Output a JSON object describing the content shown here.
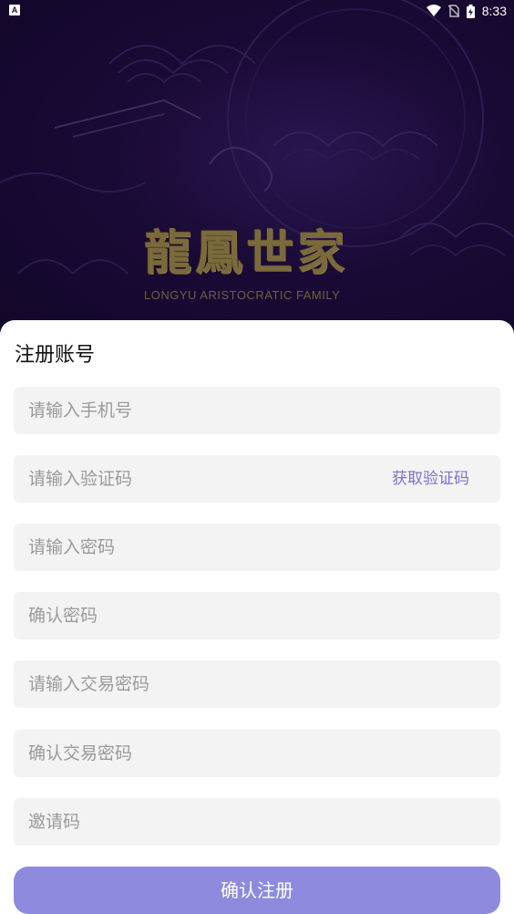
{
  "status_bar": {
    "notification_icon_letter": "A",
    "time": "8:33",
    "icons": [
      "wifi-icon",
      "no-sim-icon",
      "battery-charging-icon"
    ]
  },
  "banner": {
    "logo_characters": "龍鳳世家",
    "logo_subtitle": "LONGYU ARISTOCRATIC FAMILY"
  },
  "form": {
    "title": "注册账号",
    "fields": [
      {
        "name": "phone",
        "placeholder": "请输入手机号",
        "value": ""
      },
      {
        "name": "verification_code",
        "placeholder": "请输入验证码",
        "value": ""
      },
      {
        "name": "password",
        "placeholder": "请输入密码",
        "value": ""
      },
      {
        "name": "confirm_password",
        "placeholder": "确认密码",
        "value": ""
      },
      {
        "name": "trade_password",
        "placeholder": "请输入交易密码",
        "value": ""
      },
      {
        "name": "confirm_trade_password",
        "placeholder": "确认交易密码",
        "value": ""
      },
      {
        "name": "invite_code",
        "placeholder": "邀请码",
        "value": ""
      }
    ],
    "get_code_label": "获取验证码",
    "submit_label": "确认注册"
  },
  "colors": {
    "accent": "#8e8ade",
    "link": "#7b72c8",
    "hero_bg": "#190a35",
    "field_bg": "#f3f3f3",
    "logo_gold": "#7a6a3c"
  }
}
